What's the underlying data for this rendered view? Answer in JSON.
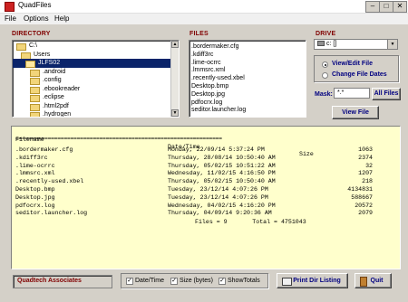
{
  "window": {
    "title": "QuadFiles"
  },
  "menu": [
    "File",
    "Options",
    "Help"
  ],
  "directory": {
    "label": "DIRECTORY",
    "rows": [
      {
        "label": "C:\\",
        "indent": 0,
        "selected": false
      },
      {
        "label": "Users",
        "indent": 1,
        "selected": false
      },
      {
        "label": "JLFS02",
        "indent": 2,
        "selected": true
      },
      {
        "label": ".android",
        "indent": 3,
        "selected": false
      },
      {
        "label": ".config",
        "indent": 3,
        "selected": false
      },
      {
        "label": ".ebookreader",
        "indent": 3,
        "selected": false
      },
      {
        "label": ".eclipse",
        "indent": 3,
        "selected": false
      },
      {
        "label": ".html2pdf",
        "indent": 3,
        "selected": false
      },
      {
        "label": ".hydrogen",
        "indent": 3,
        "selected": false
      }
    ]
  },
  "files": {
    "label": "FILES",
    "items": [
      ".bordermaker.cfg",
      ".kdiff3rc",
      ".lime-ocrrc",
      ".lmmsrc.xml",
      ".recently-used.xbel",
      "Desktop.bmp",
      "Desktop.jpg",
      "pdfocrx.log",
      "seditor.launcher.log"
    ]
  },
  "drive": {
    "label": "DRIVE",
    "value": "c: []"
  },
  "mode": {
    "view_edit": "View/Edit File",
    "change_dates": "Change File Dates",
    "selected": "view_edit"
  },
  "mask": {
    "label": "Mask:",
    "value": "*.*"
  },
  "buttons": {
    "all_files": "All Files",
    "view_file": "View File",
    "print": "Print Dir Listing",
    "quit": "Quit"
  },
  "listing": {
    "headers": {
      "filename": "Filename",
      "datetime": "Date/Time",
      "size": "Size"
    },
    "separator": "================================================================",
    "rows": [
      {
        "name": ".bordermaker.cfg",
        "date": "Monday, 22/09/14 5:37:24 PM",
        "size": "1063"
      },
      {
        "name": ".kdiff3rc",
        "date": "Thursday, 28/08/14 10:50:40 AM",
        "size": "2374"
      },
      {
        "name": ".lime-ocrrc",
        "date": "Thursday, 05/02/15 10:51:22 AM",
        "size": "32"
      },
      {
        "name": ".lmmsrc.xml",
        "date": "Wednesday, 11/02/15 4:16:50 PM",
        "size": "1207"
      },
      {
        "name": ".recently-used.xbel",
        "date": "Thursday, 05/02/15 10:50:40 AM",
        "size": "218"
      },
      {
        "name": "Desktop.bmp",
        "date": "Tuesday, 23/12/14 4:07:26 PM",
        "size": "4134831"
      },
      {
        "name": "Desktop.jpg",
        "date": "Tuesday, 23/12/14 4:07:26 PM",
        "size": "588667"
      },
      {
        "name": "pdfocrx.log",
        "date": "Wednesday, 04/02/15 4:16:20 PM",
        "size": "20572"
      },
      {
        "name": "seditor.launcher.log",
        "date": "Thursday, 04/09/14 9:20:36 AM",
        "size": "2079"
      }
    ],
    "summary": "Files = 9       Total = 4751043"
  },
  "footer": {
    "company": "Quadtech Associates",
    "options": [
      {
        "label": "Date/Time",
        "checked": true
      },
      {
        "label": "Size (bytes)",
        "checked": true
      },
      {
        "label": "ShowTotals",
        "checked": true
      }
    ]
  },
  "colors": {
    "accent": "#800000",
    "button_text": "#000080",
    "selection": "#0a246a",
    "listing_bg": "#ffffcc"
  }
}
